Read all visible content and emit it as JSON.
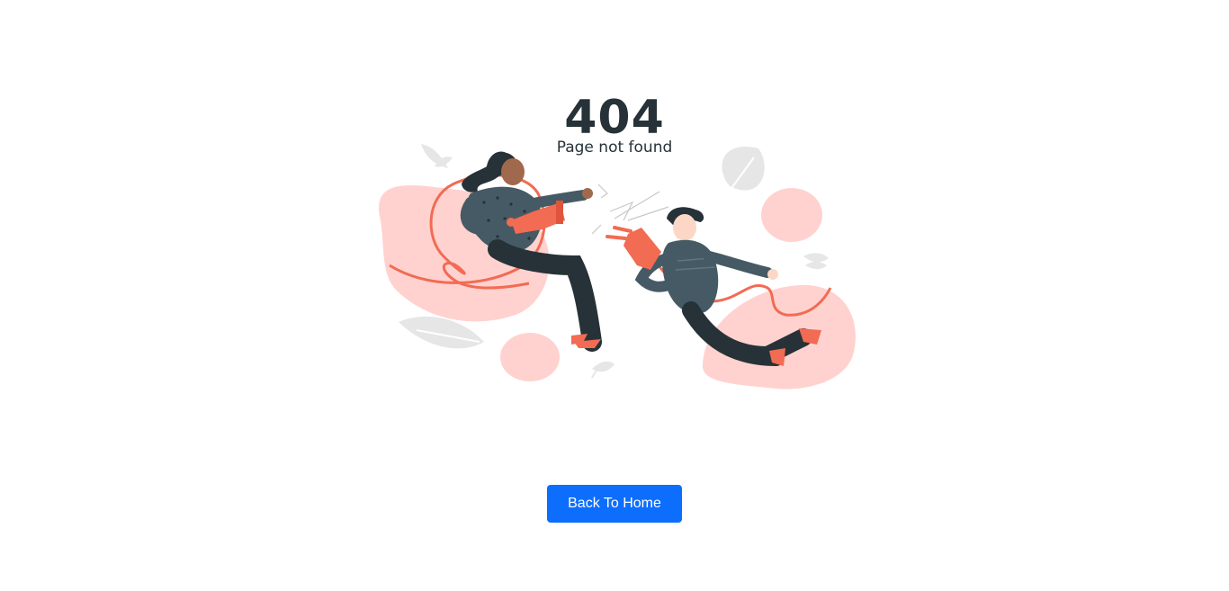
{
  "error": {
    "code": "404",
    "message": "Page not found"
  },
  "actions": {
    "home_label": "Back To Home"
  },
  "colors": {
    "primary_button": "#0d6efd",
    "text_dark": "#263238",
    "accent_coral": "#f26b53",
    "blob_pink": "#ffd2cf",
    "leaf_gray": "#ebebeb"
  }
}
